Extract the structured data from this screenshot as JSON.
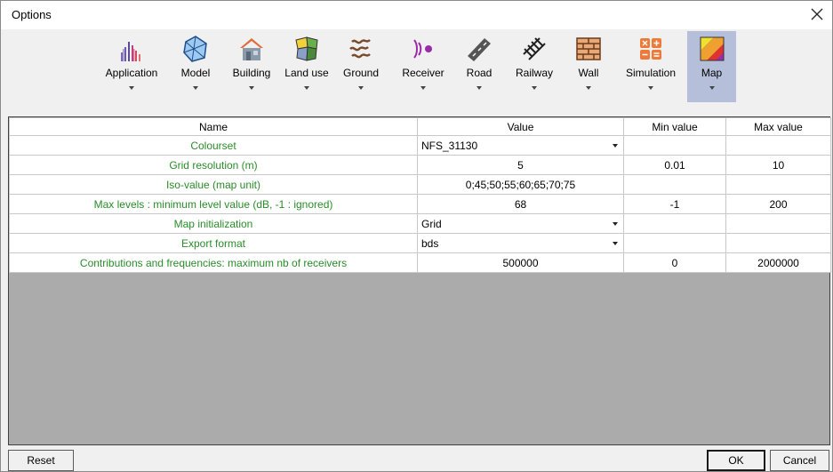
{
  "window": {
    "title": "Options"
  },
  "toolbar": {
    "tabs": [
      {
        "label": "Application",
        "icon": "application-icon",
        "active": false
      },
      {
        "label": "Model",
        "icon": "model-icon",
        "active": false
      },
      {
        "label": "Building",
        "icon": "building-icon",
        "active": false
      },
      {
        "label": "Land use",
        "icon": "land-use-icon",
        "active": false
      },
      {
        "label": "Ground",
        "icon": "ground-icon",
        "active": false
      },
      {
        "label": "Receiver",
        "icon": "receiver-icon",
        "active": false
      },
      {
        "label": "Road",
        "icon": "road-icon",
        "active": false
      },
      {
        "label": "Railway",
        "icon": "railway-icon",
        "active": false
      },
      {
        "label": "Wall",
        "icon": "wall-icon",
        "active": false
      },
      {
        "label": "Simulation",
        "icon": "simulation-icon",
        "active": false
      },
      {
        "label": "Map",
        "icon": "map-icon",
        "active": true
      }
    ]
  },
  "grid": {
    "columns": [
      "Name",
      "Value",
      "Min value",
      "Max value"
    ],
    "rows": [
      {
        "name": "Colourset",
        "value": "NFS_31130",
        "min": "",
        "max": "",
        "combo": true
      },
      {
        "name": "Grid resolution (m)",
        "value": "5",
        "min": "0.01",
        "max": "10",
        "combo": false
      },
      {
        "name": "Iso-value (map unit)",
        "value": "0;45;50;55;60;65;70;75",
        "min": "",
        "max": "",
        "combo": false
      },
      {
        "name": "Max levels : minimum level value (dB, -1 : ignored)",
        "value": "68",
        "min": "-1",
        "max": "200",
        "combo": false
      },
      {
        "name": "Map initialization",
        "value": "Grid",
        "min": "",
        "max": "",
        "combo": true
      },
      {
        "name": "Export format",
        "value": "bds",
        "min": "",
        "max": "",
        "combo": true
      },
      {
        "name": "Contributions and frequencies: maximum nb of receivers",
        "value": "500000",
        "min": "0",
        "max": "2000000",
        "combo": false
      }
    ]
  },
  "buttons": {
    "reset": "Reset",
    "ok": "OK",
    "cancel": "Cancel"
  },
  "colors": {
    "active_tab": "#b5bfd9",
    "name_text": "#2a8c2a",
    "empty_area": "#ababab"
  }
}
